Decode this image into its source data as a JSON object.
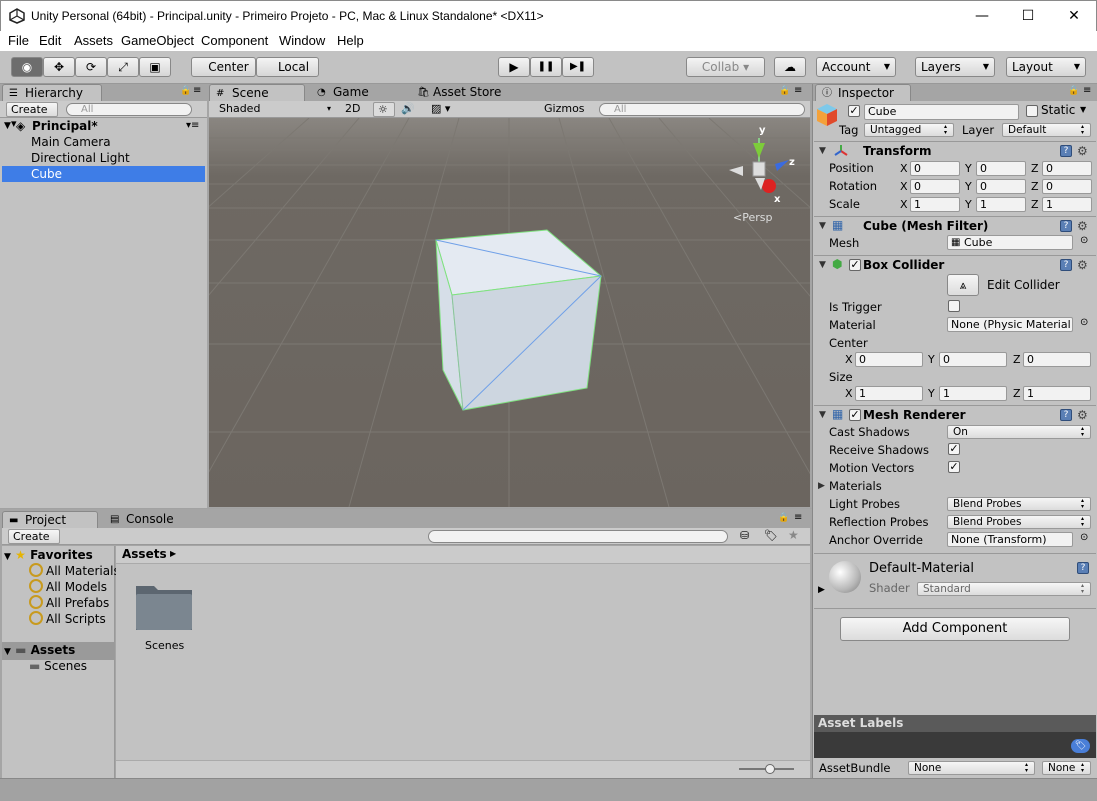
{
  "window": {
    "title": "Unity Personal (64bit) - Principal.unity - Primeiro Projeto - PC, Mac & Linux Standalone* <DX11>",
    "minimize": "—",
    "maximize": "☐",
    "close": "✕"
  },
  "menu": [
    "File",
    "Edit",
    "Assets",
    "GameObject",
    "Component",
    "Window",
    "Help"
  ],
  "toolbar": {
    "pivot_center": "Center",
    "pivot_local": "Local",
    "collab": "Collab",
    "account": "Account",
    "layers": "Layers",
    "layout": "Layout",
    "play": "▶",
    "pause": "❚❚",
    "step": "▶❚"
  },
  "hierarchy": {
    "tab": "Hierarchy",
    "create": "Create",
    "search_placeholder": "All",
    "scene": "Principal*",
    "items": [
      "Main Camera",
      "Directional Light",
      "Cube"
    ],
    "selected": "Cube"
  },
  "scene_view": {
    "tabs": [
      "Scene",
      "Game",
      "Asset Store"
    ],
    "shading": "Shaded",
    "mode_2d": "2D",
    "gizmos": "Gizmos",
    "search_placeholder": "All",
    "persp_label": "Persp",
    "axis_x": "x",
    "axis_y": "y",
    "axis_z": "z"
  },
  "inspector": {
    "tab": "Inspector",
    "object_name": "Cube",
    "static_label": "Static",
    "tag_label": "Tag",
    "tag_value": "Untagged",
    "layer_label": "Layer",
    "layer_value": "Default",
    "transform": {
      "title": "Transform",
      "position_label": "Position",
      "rotation_label": "Rotation",
      "scale_label": "Scale",
      "position": [
        "0",
        "0",
        "0"
      ],
      "rotation": [
        "0",
        "0",
        "0"
      ],
      "scale": [
        "1",
        "1",
        "1"
      ]
    },
    "mesh_filter": {
      "title": "Cube (Mesh Filter)",
      "mesh_label": "Mesh",
      "mesh_value": "Cube"
    },
    "box_collider": {
      "title": "Box Collider",
      "edit_collider": "Edit Collider",
      "is_trigger_label": "Is Trigger",
      "material_label": "Material",
      "material_value": "None (Physic Material",
      "center_label": "Center",
      "size_label": "Size",
      "center": [
        "0",
        "0",
        "0"
      ],
      "size": [
        "1",
        "1",
        "1"
      ]
    },
    "mesh_renderer": {
      "title": "Mesh Renderer",
      "cast_shadows_label": "Cast Shadows",
      "cast_shadows_value": "On",
      "receive_shadows_label": "Receive Shadows",
      "motion_vectors_label": "Motion Vectors",
      "materials_label": "Materials",
      "light_probes_label": "Light Probes",
      "light_probes_value": "Blend Probes",
      "reflection_probes_label": "Reflection Probes",
      "reflection_probes_value": "Blend Probes",
      "anchor_override_label": "Anchor Override",
      "anchor_override_value": "None (Transform)"
    },
    "material": {
      "name": "Default-Material",
      "shader_label": "Shader",
      "shader_value": "Standard"
    },
    "add_component": "Add Component",
    "asset_labels": "Asset Labels",
    "asset_bundle_label": "AssetBundle",
    "asset_bundle_value": "None",
    "asset_bundle_variant": "None"
  },
  "project": {
    "tabs": [
      "Project",
      "Console"
    ],
    "create": "Create",
    "favorites_label": "Favorites",
    "favorites": [
      "All Materials",
      "All Models",
      "All Prefabs",
      "All Scripts"
    ],
    "assets_label": "Assets",
    "asset_folders": [
      "Scenes"
    ],
    "breadcrumb": "Assets",
    "grid_items": [
      "Scenes"
    ]
  },
  "axis": {
    "x": "X",
    "y": "Y",
    "z": "Z"
  }
}
